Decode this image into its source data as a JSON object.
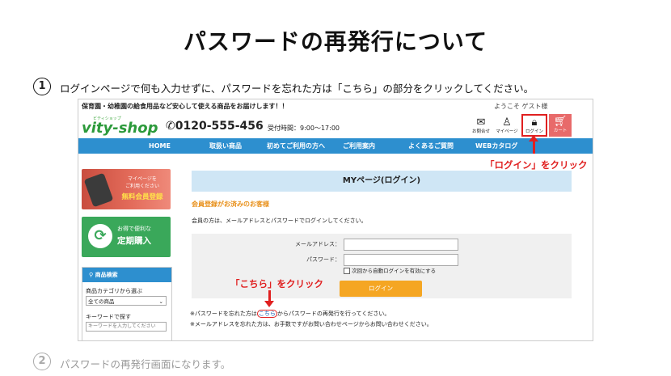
{
  "slide": {
    "title": "パスワードの再発行について",
    "step1": {
      "num": "1",
      "text": "ログインページで何も入力せずに、パスワードを忘れた方は「こちら」の部分をクリックしてください。"
    },
    "step2": {
      "num": "2",
      "text": "パスワードの再発行画面になります。"
    },
    "callout_login": "「ログイン」をクリック",
    "callout_kochira": "「こちら」をクリック",
    "colors": {
      "accent_red": "#e02020",
      "nav_blue": "#2d8fcf",
      "button_orange": "#f5a623"
    }
  },
  "site": {
    "tagline": "保育園・幼稚園の給食用品など安心して使える商品をお届けします！！",
    "greeting": "ようこそ ゲスト様",
    "logo": "vity-shop",
    "logo_sub": "ビティショップ",
    "phone": "0120-555-456",
    "hours": "受付時間：9:00～17:00",
    "header_icons": [
      {
        "icon": "mail-icon",
        "label": "お問合せ"
      },
      {
        "icon": "user-icon",
        "label": "マイページ"
      },
      {
        "icon": "lock-icon",
        "label": "ログイン"
      },
      {
        "icon": "cart-icon",
        "label": "カート"
      }
    ],
    "nav": [
      "HOME",
      "取扱い商品",
      "初めてご利用の方へ",
      "ご利用案内",
      "よくあるご質問",
      "WEBカタログ"
    ],
    "sidebar": {
      "banner1_line1": "マイページを",
      "banner1_line2": "ご利用ください",
      "banner1_strong": "無料会員登録",
      "banner2_line1": "お得で便利な",
      "banner2_strong": "定期購入",
      "search_title": "商品検索",
      "category_label": "商品カテゴリから選ぶ",
      "category_value": "全ての商品",
      "keyword_label": "キーワードで探す",
      "keyword_placeholder": "キーワードを入力してください"
    },
    "main": {
      "page_heading": "MYページ(ログイン)",
      "section_title": "会員登録がお済みのお客様",
      "intro": "会員の方は、メールアドレスとパスワードでログインしてください。",
      "email_label": "メールアドレス：",
      "password_label": "パスワード：",
      "auto_login": "次回から自動ログインを有効にする",
      "login_button": "ログイン",
      "forgot_pre": "※パスワードを忘れた方は",
      "forgot_link": "こちら",
      "forgot_post": "からパスワードの再発行を行ってください。",
      "email_note": "※メールアドレスを忘れた方は、お手数ですがお問い合わせページからお問い合わせください。"
    }
  }
}
